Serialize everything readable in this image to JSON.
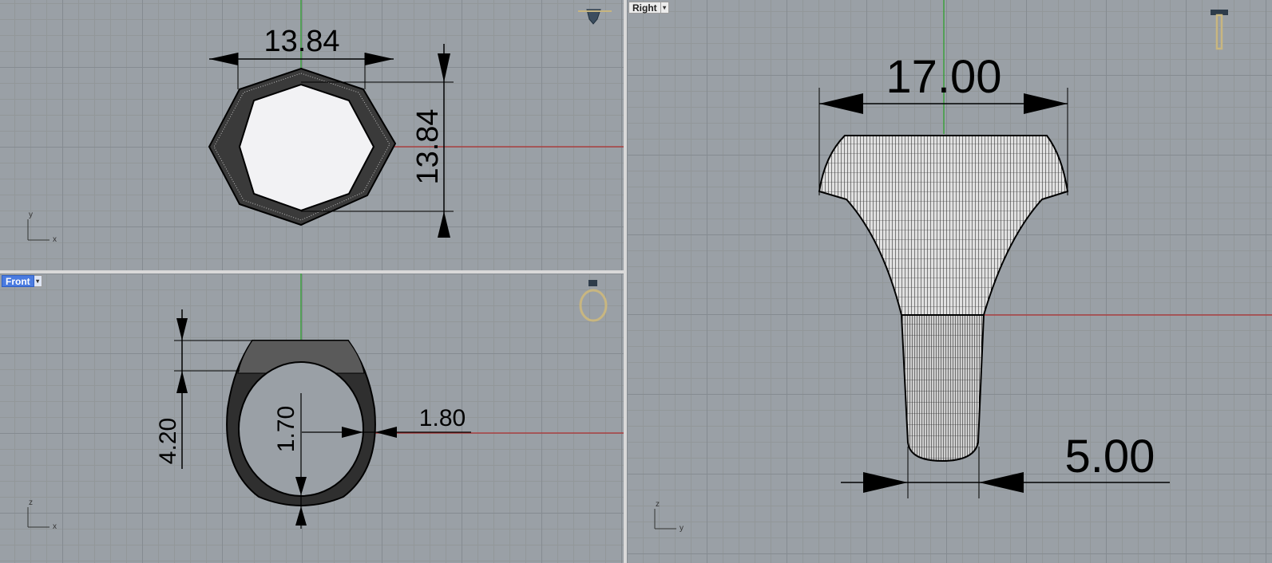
{
  "viewports": {
    "top": {
      "label": "",
      "axis_x": "x",
      "axis_y": "y",
      "dims": {
        "width": "13.84",
        "height": "13.84"
      },
      "widget_icon": "gem-view-widget-icon"
    },
    "front": {
      "label": "Front",
      "axis_x": "x",
      "axis_y": "z",
      "dims": {
        "top_height": "4.20",
        "inner_thickness": "1.70",
        "side_thickness": "1.80"
      },
      "widget_icon": "ring-view-widget-icon"
    },
    "right": {
      "label": "Right",
      "axis_x": "y",
      "axis_y": "z",
      "dims": {
        "top_width": "17.00",
        "shank_width": "5.00"
      },
      "widget_icon": "ring-side-view-widget-icon"
    }
  },
  "colors": {
    "grid_bg": "#9aa0a6",
    "x_axis": "#b03030",
    "y_axis": "#2fa02f",
    "active_label": "#4a7be0"
  }
}
